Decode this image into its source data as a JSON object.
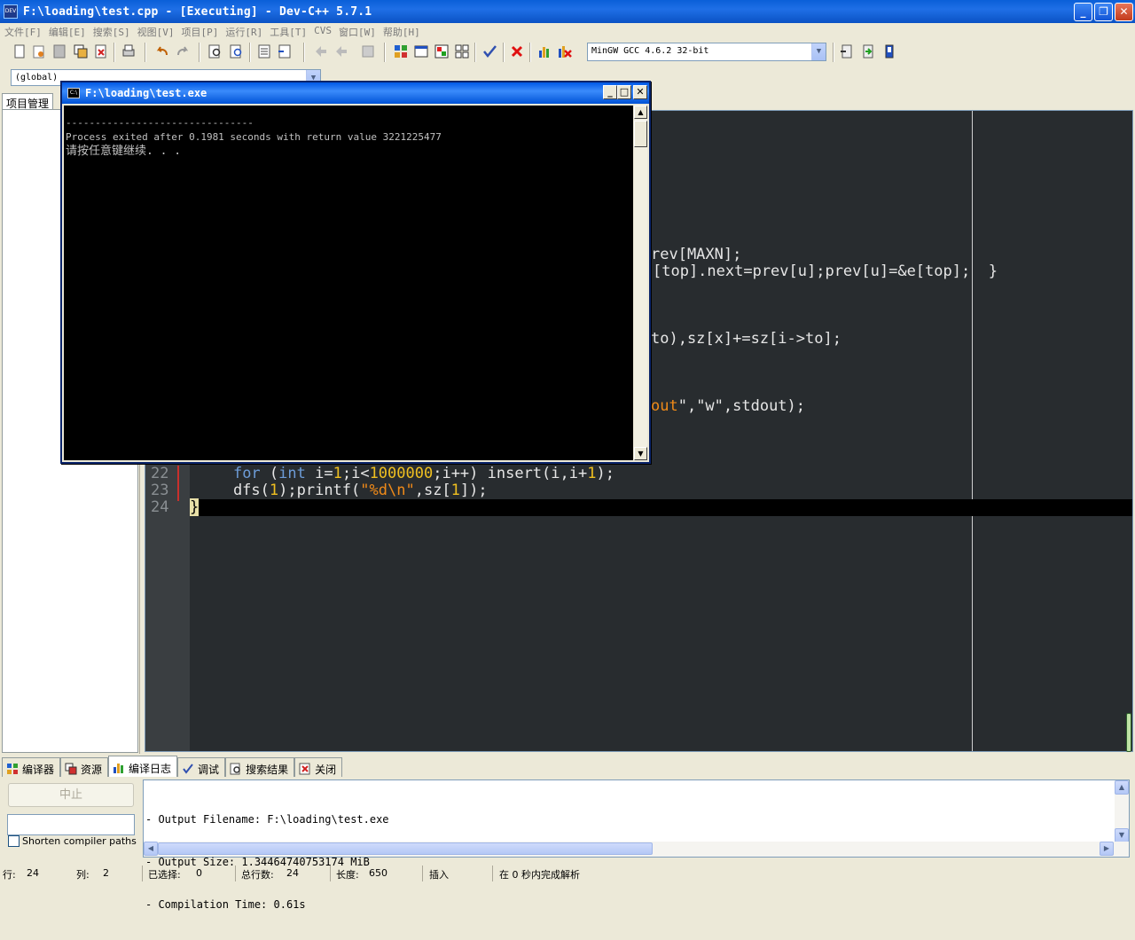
{
  "window": {
    "title": "F:\\loading\\test.cpp - [Executing] - Dev-C++ 5.7.1",
    "app_icon": "DEV"
  },
  "menu": [
    "文件[F]",
    "编辑[E]",
    "搜索[S]",
    "视图[V]",
    "项目[P]",
    "运行[R]",
    "工具[T]",
    "CVS",
    "窗口[W]",
    "帮助[H]"
  ],
  "toolbar": {
    "compiler": "MinGW GCC 4.6.2 32-bit"
  },
  "scope": {
    "value": "(global)"
  },
  "left_panel": {
    "tab": "项目管理"
  },
  "editor": {
    "visible_fragments": [
      "rev[MAXN];",
      "[top].next=prev[u];prev[u]=&e[top];  }",
      "to),sz[x]+=sz[i->to];",
      "\",\"w\",stdout);"
    ],
    "lines": [
      {
        "num": "22",
        "text": "    for (int i=1;i<1000000;i++) insert(i,i+1);"
      },
      {
        "num": "23",
        "text": "    dfs(1);printf(\"%d\\n\",sz[1]);"
      },
      {
        "num": "24",
        "text": "}"
      }
    ]
  },
  "console": {
    "title": "F:\\loading\\test.exe",
    "icon": "C:\\",
    "lines": [
      "--------------------------------",
      "Process exited after 0.1981 seconds with return value 3221225477",
      "请按任意键继续. . ."
    ]
  },
  "bottom_tabs": [
    {
      "label": "编译器",
      "icon": "grid-icon"
    },
    {
      "label": "资源",
      "icon": "resource-icon"
    },
    {
      "label": "编译日志",
      "icon": "chart-icon"
    },
    {
      "label": "调试",
      "icon": "check-icon"
    },
    {
      "label": "搜索结果",
      "icon": "search-icon"
    },
    {
      "label": "关闭",
      "icon": "close-icon"
    }
  ],
  "compile_panel": {
    "stop_label": "中止",
    "shorten_label": "Shorten compiler paths",
    "log_lines": [
      "- Output Filename: F:\\loading\\test.exe",
      "- Output Size: 1.34464740753174 MiB",
      "- Compilation Time: 0.61s"
    ]
  },
  "status": {
    "row_label": "行:",
    "row": "24",
    "col_label": "列:",
    "col": "2",
    "sel_label": "已选择:",
    "sel": "0",
    "lines_label": "总行数:",
    "lines": "24",
    "len_label": "长度:",
    "len": "650",
    "mode": "插入",
    "parse": "在 0 秒内完成解析"
  },
  "colors": {
    "editor_bg": "#282c2f",
    "keyword": "#6d9cd8",
    "number": "#f0c020",
    "string": "#f08a18",
    "title_blue": "#0a5fd8"
  }
}
